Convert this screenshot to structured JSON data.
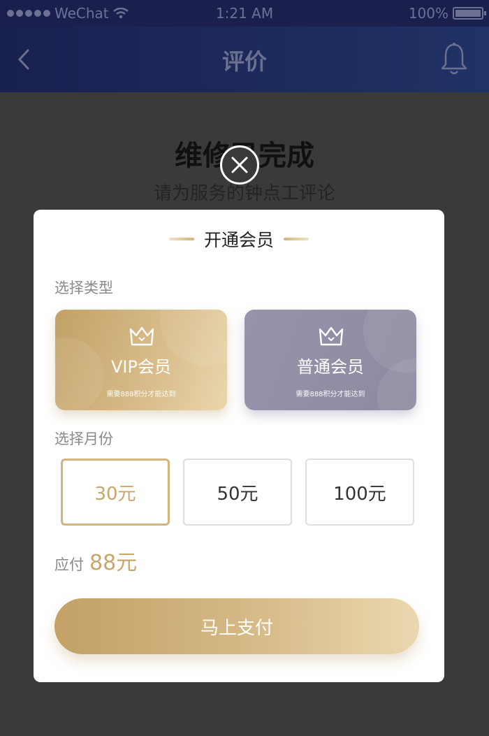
{
  "status_bar": {
    "carrier": "WeChat",
    "time": "1:21 AM",
    "battery": "100%"
  },
  "nav": {
    "title": "评价",
    "back_icon": "chevron-left-icon",
    "bell_icon": "bell-icon"
  },
  "page": {
    "heading": "维修已完成",
    "subheading": "请为服务的钟点工评论"
  },
  "modal": {
    "close_icon": "close-icon",
    "title": "开通会员",
    "type_label": "选择类型",
    "month_label": "选择月份",
    "member_types": [
      {
        "name": "VIP会员",
        "note": "需要888积分才能达到",
        "icon": "crown-icon",
        "color": "#c9a66c"
      },
      {
        "name": "普通会员",
        "note": "需要888积分才能达到",
        "icon": "crown-icon",
        "color": "#938ea5"
      }
    ],
    "months": [
      {
        "label": "30元",
        "selected": true
      },
      {
        "label": "50元",
        "selected": false
      },
      {
        "label": "100元",
        "selected": false
      }
    ],
    "pay_label": "应付",
    "pay_amount": "88元",
    "pay_button": "马上支付"
  },
  "colors": {
    "gold": "#c9a66c",
    "nav_bg": "#1a1f4e",
    "overlay": "#3a3a3c"
  }
}
